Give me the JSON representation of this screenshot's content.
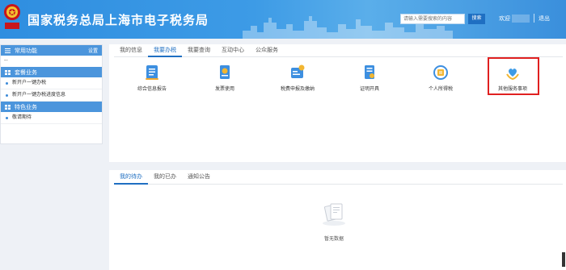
{
  "header": {
    "title": "国家税务总局上海市电子税务局",
    "search": {
      "placeholder": "请输入需要搜索的内容",
      "button_label": "搜索"
    },
    "welcome": "欢迎",
    "logout": "退出",
    "emblem_text": "中国税务",
    "colors": {
      "bar": "#3d9be6",
      "search_button": "#1f6fc2"
    }
  },
  "sidebar": {
    "common_title": "常用功能",
    "settings_label": "设置",
    "placeholder_dash": "--",
    "sections": [
      {
        "title": "套餐业务",
        "items": [
          "新开户一键办税",
          "新开户一键办税进度信息"
        ]
      },
      {
        "title": "特色业务",
        "items": [
          "敬请期待"
        ]
      }
    ]
  },
  "main": {
    "tabs": [
      {
        "label": "我的信息",
        "active": false
      },
      {
        "label": "我要办税",
        "active": true
      },
      {
        "label": "我要查询",
        "active": false
      },
      {
        "label": "互动中心",
        "active": false
      },
      {
        "label": "公众服务",
        "active": false
      }
    ],
    "functions": [
      {
        "label": "综合信息报告",
        "icon": "report-icon"
      },
      {
        "label": "发票使用",
        "icon": "invoice-icon"
      },
      {
        "label": "税费申报及缴纳",
        "icon": "tax-declaration-icon"
      },
      {
        "label": "证明开具",
        "icon": "certificate-icon"
      },
      {
        "label": "个人所得税",
        "icon": "personal-income-tax-icon"
      },
      {
        "label": "其他服务事项",
        "icon": "other-services-heart-icon",
        "highlighted": true
      }
    ],
    "accent_color": "#1f6fc2",
    "highlight_color": "#e02020"
  },
  "bottom": {
    "tabs": [
      {
        "label": "我的待办",
        "active": true
      },
      {
        "label": "我的已办",
        "active": false
      },
      {
        "label": "通知公告",
        "active": false
      }
    ],
    "empty_text": "暂无数据"
  }
}
